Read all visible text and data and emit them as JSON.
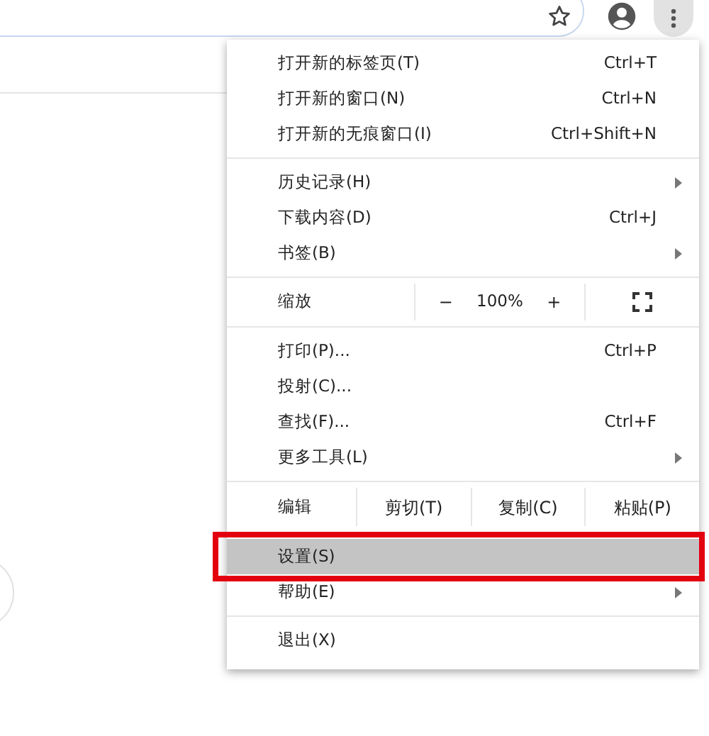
{
  "menu": {
    "sections": [
      {
        "kind": "items",
        "items": [
          {
            "label": "打开新的标签页(T)",
            "shortcut": "Ctrl+T",
            "submenu": false,
            "selected": false,
            "outlined": false
          },
          {
            "label": "打开新的窗口(N)",
            "shortcut": "Ctrl+N",
            "submenu": false,
            "selected": false,
            "outlined": false
          },
          {
            "label": "打开新的无痕窗口(I)",
            "shortcut": "Ctrl+Shift+N",
            "submenu": false,
            "selected": false,
            "outlined": false
          }
        ]
      },
      {
        "kind": "items",
        "items": [
          {
            "label": "历史记录(H)",
            "submenu": true,
            "selected": false,
            "outlined": false
          },
          {
            "label": "下载内容(D)",
            "shortcut": "Ctrl+J",
            "submenu": false,
            "selected": false,
            "outlined": false
          },
          {
            "label": "书签(B)",
            "submenu": true,
            "selected": false,
            "outlined": false
          }
        ]
      },
      {
        "kind": "zoom",
        "label": "缩放",
        "minus": "−",
        "value": "100%",
        "plus": "+"
      },
      {
        "kind": "items",
        "items": [
          {
            "label": "打印(P)...",
            "shortcut": "Ctrl+P",
            "submenu": false,
            "selected": false,
            "outlined": false
          },
          {
            "label": "投射(C)...",
            "submenu": false,
            "selected": false,
            "outlined": false
          },
          {
            "label": "查找(F)...",
            "shortcut": "Ctrl+F",
            "submenu": false,
            "selected": false,
            "outlined": false
          },
          {
            "label": "更多工具(L)",
            "submenu": true,
            "selected": false,
            "outlined": false
          }
        ]
      },
      {
        "kind": "edit",
        "label": "编辑",
        "actions": [
          "剪切(T)",
          "复制(C)",
          "粘贴(P)"
        ]
      },
      {
        "kind": "items",
        "items": [
          {
            "label": "设置(S)",
            "submenu": false,
            "selected": true,
            "outlined": true
          },
          {
            "label": "帮助(E)",
            "submenu": true,
            "selected": false,
            "outlined": false
          }
        ]
      },
      {
        "kind": "items",
        "items": [
          {
            "label": "退出(X)",
            "submenu": false,
            "selected": false,
            "outlined": false
          }
        ]
      }
    ]
  }
}
